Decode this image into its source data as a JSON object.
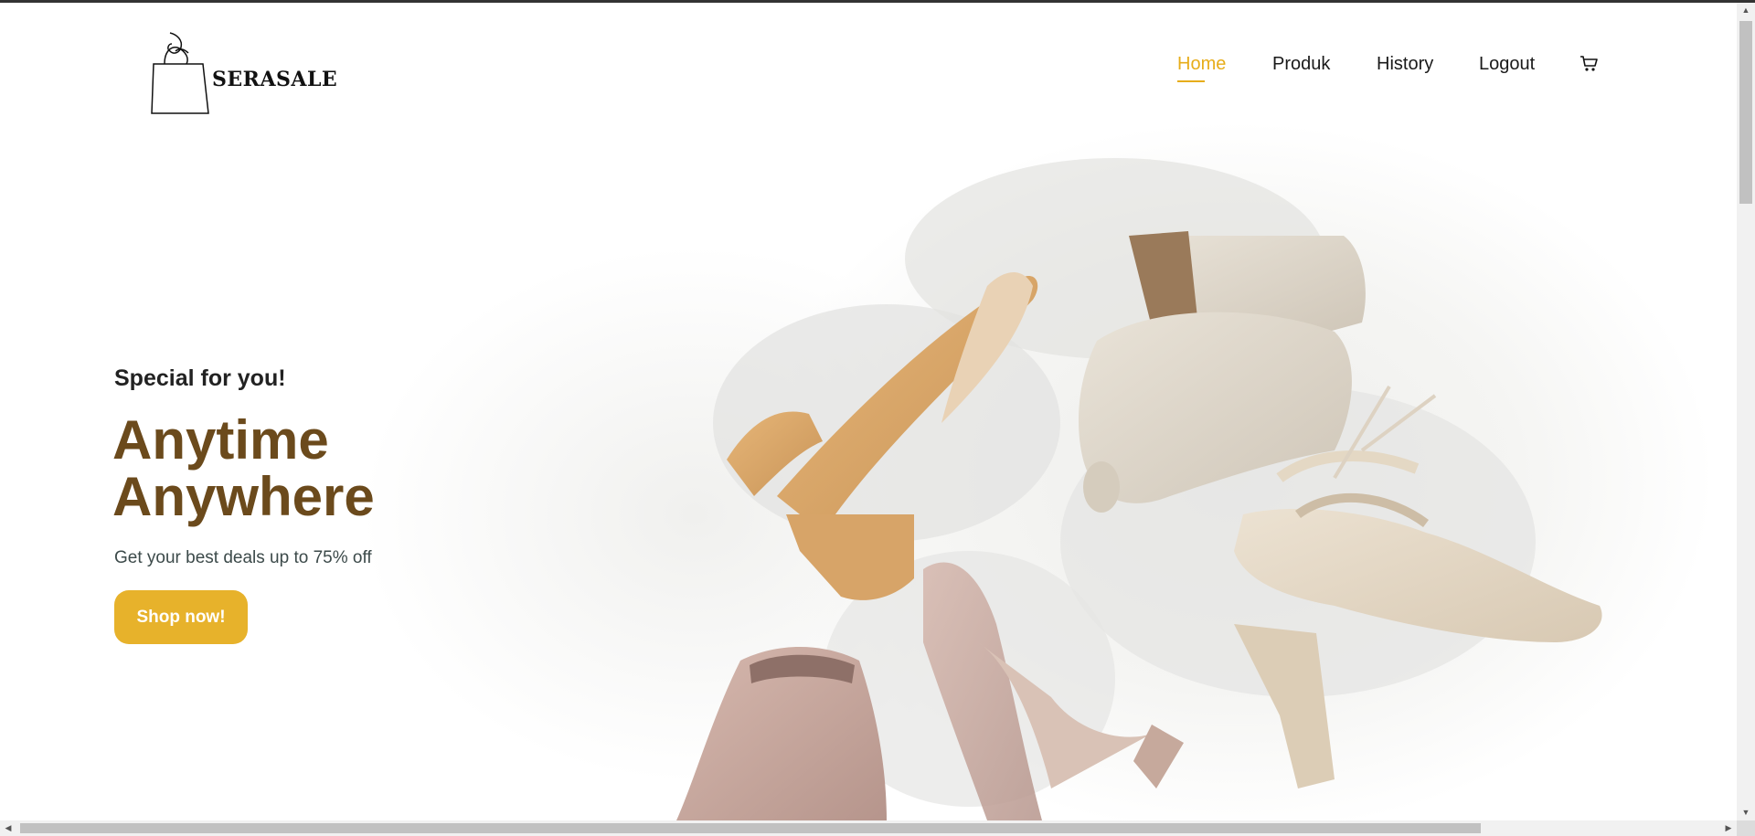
{
  "brand": {
    "name": "SERASALE",
    "logo_icon": "shopping-bag-icon"
  },
  "nav": {
    "items": [
      {
        "label": "Home",
        "active": true
      },
      {
        "label": "Produk",
        "active": false
      },
      {
        "label": "History",
        "active": false
      },
      {
        "label": "Logout",
        "active": false
      }
    ],
    "cart_icon": "cart-icon"
  },
  "hero": {
    "subtitle": "Special for you!",
    "title_line1": "Anytime",
    "title_line2": "Anywhere",
    "description": "Get your best deals up to 75% off",
    "cta_label": "Shop now!",
    "image_icon": "shoes-photo"
  },
  "colors": {
    "accent": "#e7ad1a",
    "title": "#6b4a1c",
    "button": "#e7b22b"
  }
}
